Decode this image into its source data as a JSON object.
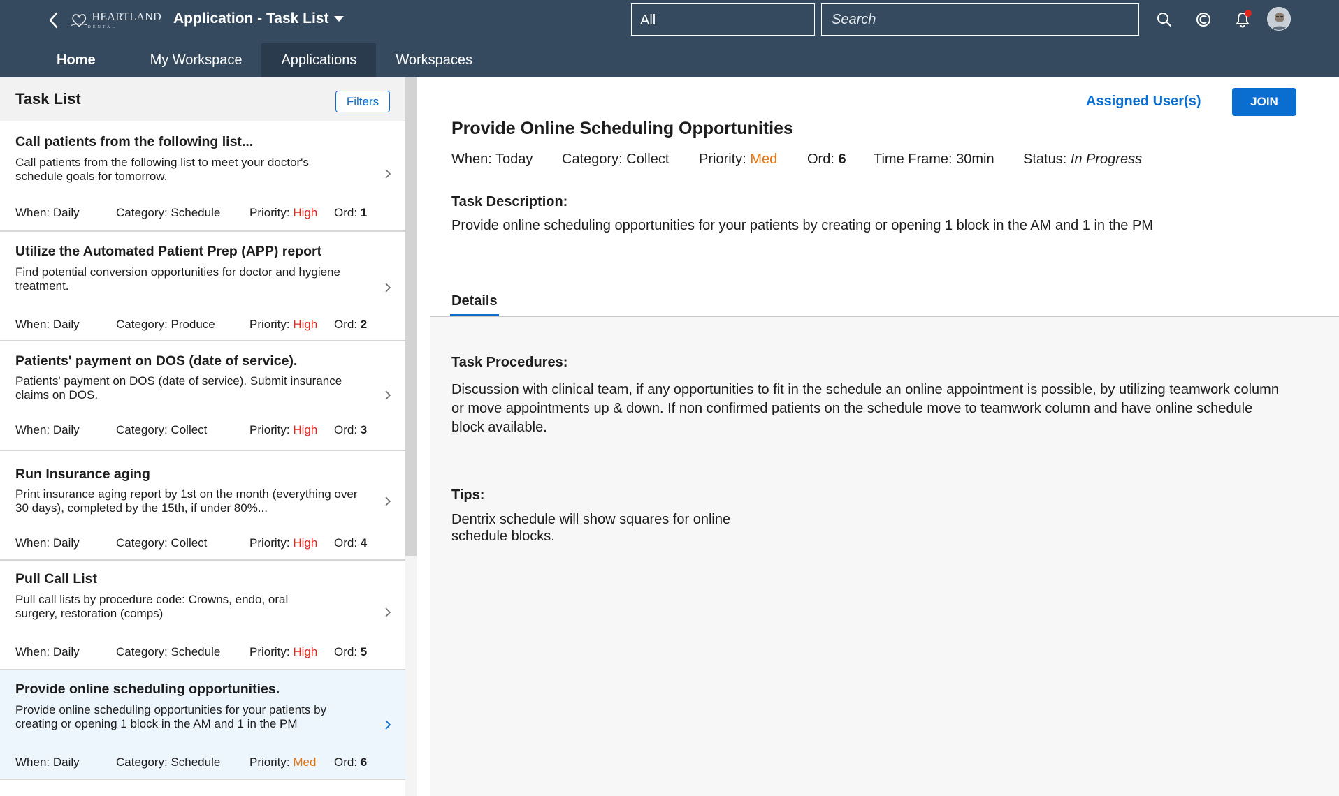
{
  "shell": {
    "logo_text": "HEARTLAND",
    "logo_sub": "DENTAL",
    "app_title": "Application - Task List",
    "scope_value": "All",
    "search_placeholder": "Search",
    "icons": [
      "back-icon",
      "search-icon",
      "copilot-icon",
      "notification-bell-icon",
      "user-avatar"
    ],
    "colors": {
      "header": "#354a5f",
      "active_nav": "#293b4d",
      "accent": "#0a6ed1",
      "high": "#e0261c",
      "med": "#e9730c"
    }
  },
  "nav": {
    "home": "Home",
    "my_workspace": "My Workspace",
    "applications": "Applications",
    "workspaces": "Workspaces"
  },
  "master": {
    "title": "Task List",
    "filters_label": "Filters",
    "when_label": "When: ",
    "category_label": "Category: ",
    "priority_label": "Priority: ",
    "ord_label": "Ord: ",
    "tasks": [
      {
        "title": "Call patients from the following list...",
        "description": "Call patients  from the following list to meet your doctor's schedule goals for tomorrow.",
        "when": "Daily",
        "category": "Schedule",
        "priority": "High",
        "ord": "1"
      },
      {
        "title": "Utilize the Automated Patient Prep (APP) report",
        "description": "Find potential conversion opportunities for doctor and hygiene treatment.",
        "when": "Daily",
        "category": "Produce",
        "priority": "High",
        "ord": "2"
      },
      {
        "title": "Patients' payment on DOS (date of service).",
        "description": "Patients' payment on DOS (date of service). Submit insurance claims on DOS.",
        "when": "Daily",
        "category": "Collect",
        "priority": "High",
        "ord": "3"
      },
      {
        "title": "Run Insurance aging",
        "description": "Print insurance aging report by 1st on the month (everything over 30 days), completed by the 15th, if under 80%...",
        "when": "Daily",
        "category": "Collect",
        "priority": "High",
        "ord": "4"
      },
      {
        "title": "Pull Call List",
        "description": "Pull call lists by procedure code: Crowns, endo, oral surgery, restoration (comps)",
        "when": "Daily",
        "category": "Schedule",
        "priority": "High",
        "ord": "5"
      },
      {
        "title": "Provide online scheduling opportunities.",
        "description": "Provide online scheduling opportunities for your patients by creating or opening 1 block in the AM and 1 in the PM",
        "when": "Daily",
        "category": "Schedule",
        "priority": "Med",
        "ord": "6"
      }
    ]
  },
  "detail": {
    "assigned_users": "Assigned User(s)",
    "join_label": "JOIN",
    "title": "Provide Online Scheduling Opportunities",
    "when": "When: Today",
    "category": "Category: Collect",
    "priority_label": "Priority: ",
    "priority_value": "Med",
    "ord_label": "Ord: ",
    "ord_value": "6",
    "time_frame": "Time Frame: 30min",
    "status_label": "Status: ",
    "status_value": "In Progress",
    "task_description_label": "Task Description:",
    "task_description": "Provide online scheduling opportunities for your patients by creating or opening 1 block in the AM and 1 in the PM",
    "tab_details": "Details",
    "procedures_label": "Task Procedures:",
    "procedures_line1": "Discussion with clinical team, if any opportunities to fit in the schedule an online appointment is possible, by utilizing teamwork column",
    "procedures_line2": "or move appointments up & down. If non confirmed patients on the schedule move to teamwork column and have online schedule",
    "procedures_line3": "block available.",
    "tips_label": "Tips:",
    "tips_line1": "Dentrix schedule will show squares for online",
    "tips_line2": "schedule blocks."
  }
}
